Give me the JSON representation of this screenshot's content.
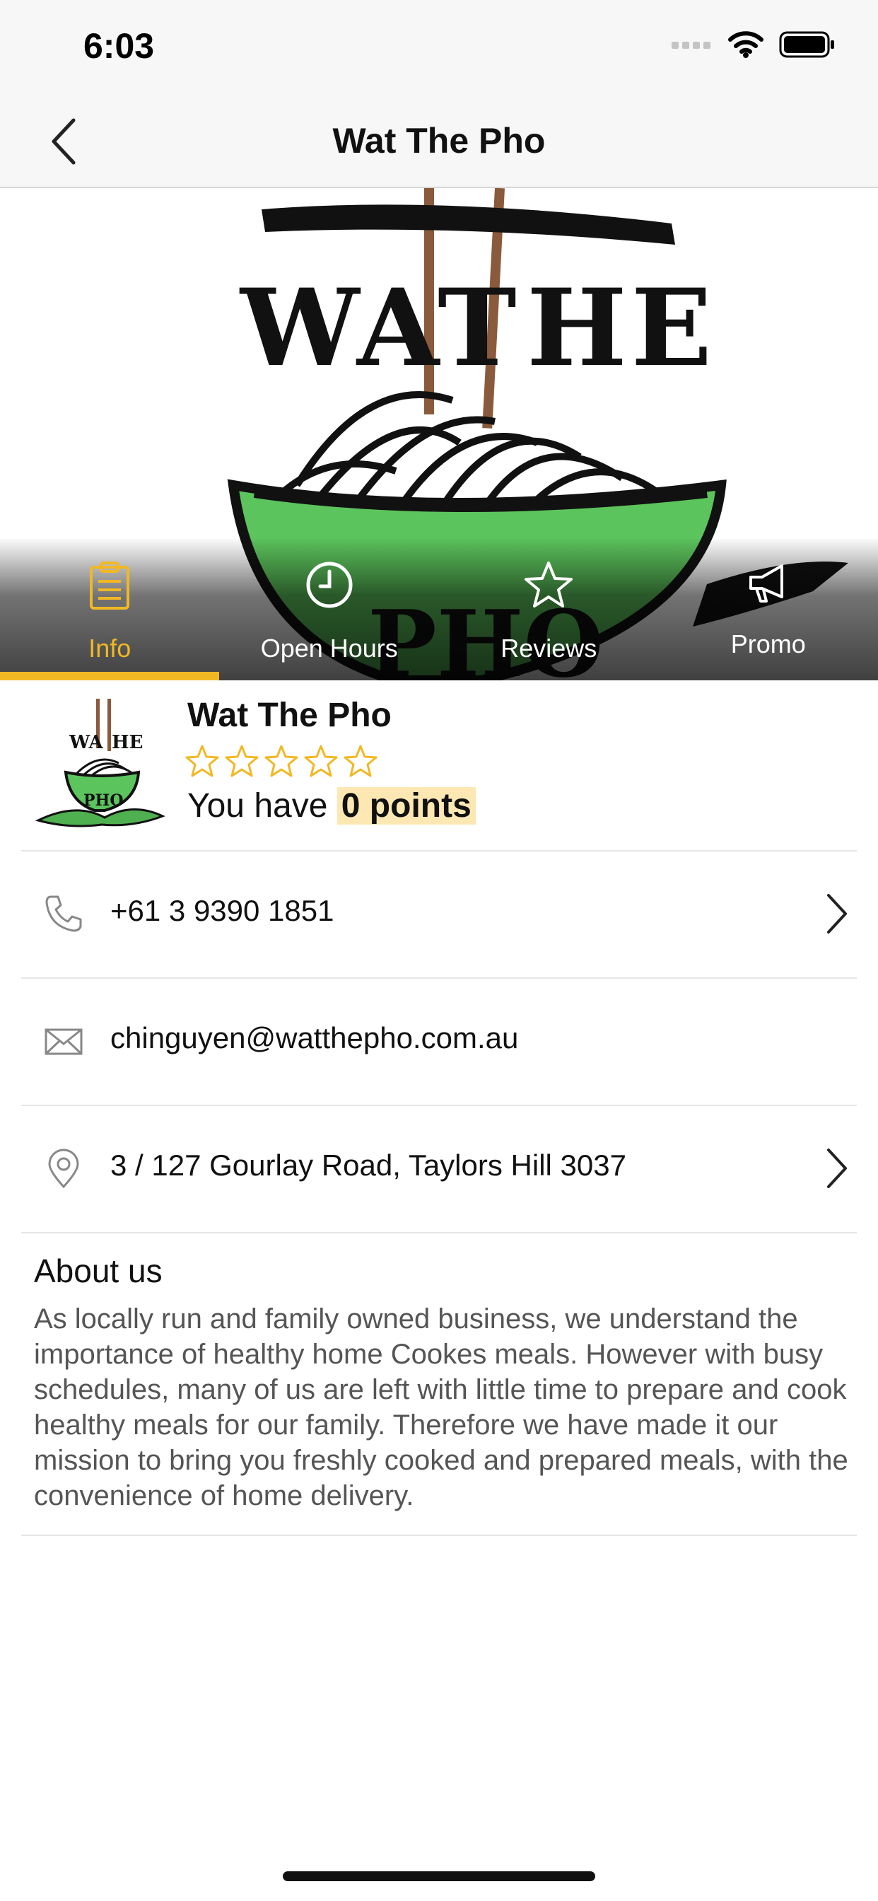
{
  "status_bar": {
    "time": "6:03"
  },
  "nav": {
    "title": "Wat The Pho"
  },
  "hero": {
    "logo_text_top": "WAT THE",
    "logo_text_bottom": "PHO"
  },
  "tabs": [
    {
      "label": "Info",
      "icon": "clipboard-icon",
      "active": true
    },
    {
      "label": "Open Hours",
      "icon": "clock-icon",
      "active": false
    },
    {
      "label": "Reviews",
      "icon": "star-icon",
      "active": false
    },
    {
      "label": "Promo",
      "icon": "megaphone-icon",
      "active": false
    }
  ],
  "profile": {
    "name": "Wat The Pho",
    "rating": 0,
    "rating_max": 5,
    "points_prefix": "You have",
    "points_value": "0 points"
  },
  "contacts": {
    "phone": "+61 3 9390 1851",
    "email": "chinguyen@watthepho.com.au",
    "address": "3 / 127 Gourlay Road, Taylors Hill 3037"
  },
  "about": {
    "title": "About us",
    "text": "As locally run and family owned business, we understand the importance of healthy home Cookes meals. However with busy schedules, many of us are left with little time to prepare and cook healthy meals for our family. Therefore we have made it our mission to bring you freshly cooked and prepared meals, with the convenience of home delivery."
  },
  "colors": {
    "accent": "#f2b824",
    "points_highlight": "#fde8b4",
    "bowl_green": "#5cc45c"
  }
}
